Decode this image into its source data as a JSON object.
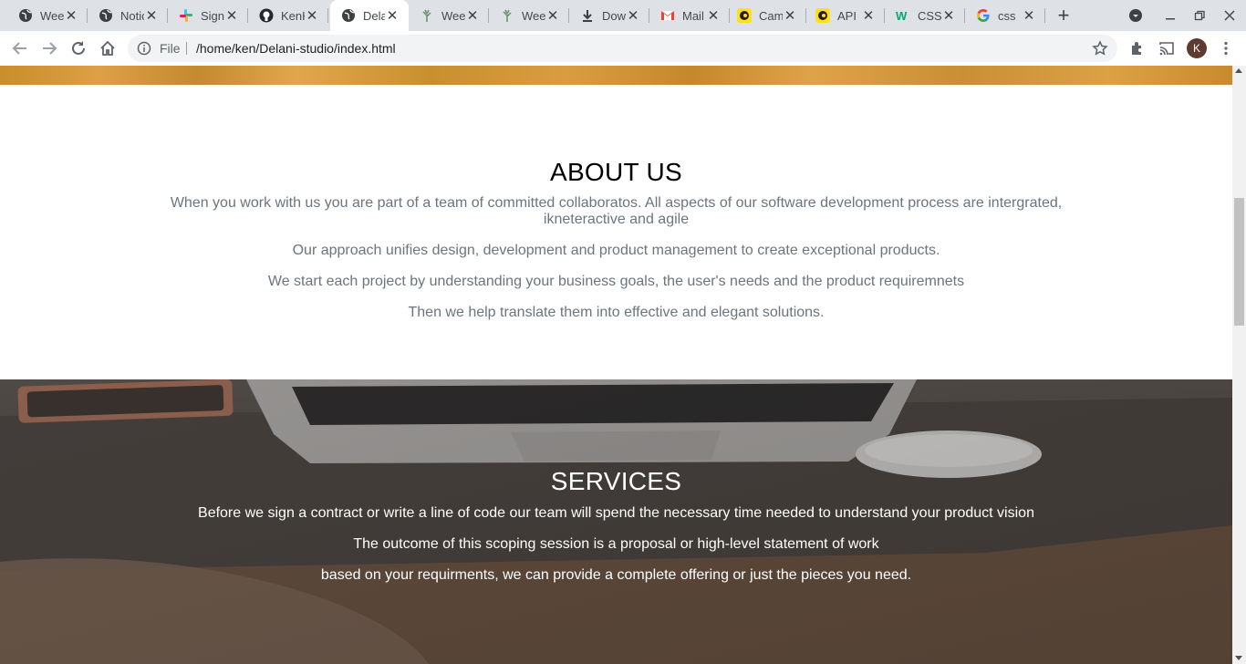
{
  "browser": {
    "tabs": [
      {
        "title": "Week",
        "icon": "globe-icon"
      },
      {
        "title": "Notion",
        "icon": "globe-icon"
      },
      {
        "title": "Sign",
        "icon": "slack-icon"
      },
      {
        "title": "KenKaranja",
        "icon": "github-icon"
      },
      {
        "title": "Delani",
        "icon": "globe-icon",
        "active": true
      },
      {
        "title": "Week",
        "icon": "tree-icon"
      },
      {
        "title": "Week",
        "icon": "tree-icon"
      },
      {
        "title": "Download",
        "icon": "download-icon"
      },
      {
        "title": "Mail",
        "icon": "gmail-icon"
      },
      {
        "title": "Campaign",
        "icon": "mailchimp-icon"
      },
      {
        "title": "API",
        "icon": "mailchimp-icon"
      },
      {
        "title": "CSS",
        "icon": "w3schools-icon"
      },
      {
        "title": "css",
        "icon": "google-icon"
      }
    ],
    "new_tab": "+",
    "omnibox": {
      "scheme_label": "File",
      "url": "/home/ken/Delani-studio/index.html"
    },
    "profile_initial": "K"
  },
  "about": {
    "heading": "ABOUT US",
    "lines": [
      "When you work with us you are part of a team of committed collaboratos. All aspects of our software development process are intergrated, ikneteractive and agile",
      "Our approach unifies design, development and product management to create exceptional products.",
      "We start each project by understanding your business goals, the user's needs and the product requiremnets",
      "Then we help translate them into effective and elegant solutions."
    ]
  },
  "services": {
    "heading": "SERVICES",
    "lines": [
      "Before we sign a contract or write a line of code our team will spend the necessary time needed to understand your product vision",
      "The outcome of this scoping session is a proposal or high-level statement of work",
      "based on your requirments, we can provide a complete offering or just the pieces you need."
    ]
  },
  "colors": {
    "tabstrip": "#dee1e6",
    "muted_text": "#6c757d",
    "banner_orange": "#d39a3f"
  }
}
